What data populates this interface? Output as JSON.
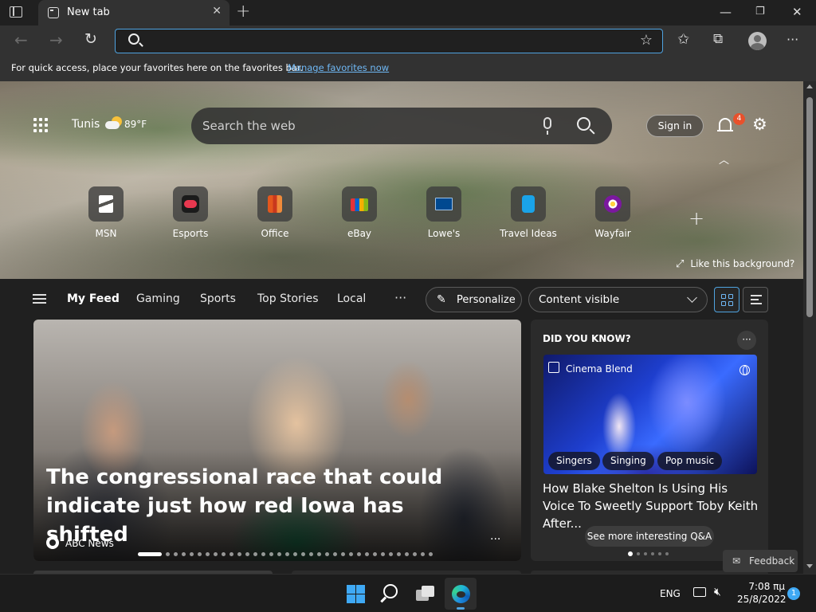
{
  "browser": {
    "tab_title": "New tab",
    "address": {
      "value": "",
      "placeholder": ""
    },
    "favorites_bar": {
      "message": "For quick access, place your favorites here on the favorites bar.",
      "link": "Manage favorites now"
    }
  },
  "header": {
    "weather": {
      "city": "Tunis",
      "temp": "89",
      "unit": "°F"
    },
    "search": {
      "placeholder": "Search the web"
    },
    "sign_in": "Sign in",
    "notifications_count": "4"
  },
  "quick_links": [
    {
      "label": "MSN",
      "icon": "msn-icon",
      "color": "#ffffff"
    },
    {
      "label": "Esports",
      "icon": "esports-icon",
      "color": "#e8384f"
    },
    {
      "label": "Office",
      "icon": "office-icon",
      "color": "#e3571d"
    },
    {
      "label": "eBay",
      "icon": "ebay-icon",
      "color": "#f5af02"
    },
    {
      "label": "Lowe's",
      "icon": "lowes-icon",
      "color": "#004990"
    },
    {
      "label": "Travel Ideas",
      "icon": "travel-icon",
      "color": "#1aa3e8"
    },
    {
      "label": "Wayfair",
      "icon": "wayfair-icon",
      "color": "#7b189f"
    }
  ],
  "background_prompt": "Like this background?",
  "feed_nav": {
    "items": [
      "My Feed",
      "Gaming",
      "Sports",
      "Top Stories",
      "Local"
    ],
    "active": "My Feed",
    "personalize": "Personalize",
    "content_visible": "Content visible"
  },
  "main_story": {
    "headline": "The congressional race that could indicate just how red Iowa has shifted",
    "source": "ABC News",
    "slides": 35,
    "active_slide": 1
  },
  "did_you_know": {
    "title": "DID YOU KNOW?",
    "source": "Cinema Blend",
    "tags": [
      "Singers",
      "Singing",
      "Pop music"
    ],
    "headline": "How Blake Shelton Is Using His Voice To Sweetly Support Toby Keith After...",
    "see_more": "See more interesting Q&A",
    "pages": 6,
    "active_page": 1
  },
  "feedback": "Feedback",
  "taskbar": {
    "language": "ENG",
    "time": "7:08 πμ",
    "date": "25/8/2022",
    "notifications": "1"
  },
  "colors": {
    "accent": "#4fa3e0",
    "badge": "#e8512c",
    "link": "#6fb8f5",
    "windows_blue": "#3fa9f5"
  }
}
